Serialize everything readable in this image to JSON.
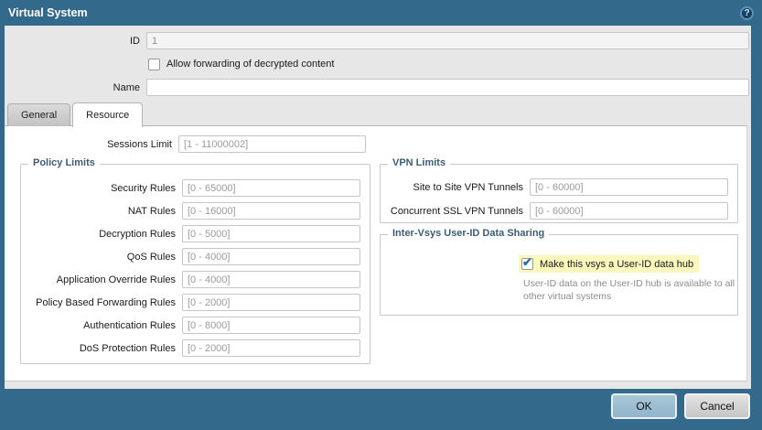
{
  "dialog": {
    "title": "Virtual System",
    "help_icon_glyph": "?",
    "top": {
      "id_label": "ID",
      "id_value": "1",
      "id_disabled": true,
      "forward_checkbox_label": "Allow forwarding of decrypted content",
      "forward_checkbox_checked": false,
      "name_label": "Name",
      "name_value": ""
    },
    "tabs": [
      {
        "label": "General",
        "active": false
      },
      {
        "label": "Resource",
        "active": true
      }
    ],
    "resource": {
      "sessions_label": "Sessions Limit",
      "sessions_placeholder": "[1 - 11000002]",
      "policy_limits": {
        "legend": "Policy Limits",
        "fields": [
          {
            "label": "Security Rules",
            "placeholder": "[0 - 65000]"
          },
          {
            "label": "NAT Rules",
            "placeholder": "[0 - 16000]"
          },
          {
            "label": "Decryption Rules",
            "placeholder": "[0 - 5000]"
          },
          {
            "label": "QoS Rules",
            "placeholder": "[0 - 4000]"
          },
          {
            "label": "Application Override Rules",
            "placeholder": "[0 - 4000]"
          },
          {
            "label": "Policy Based Forwarding Rules",
            "placeholder": "[0 - 2000]"
          },
          {
            "label": "Authentication Rules",
            "placeholder": "[0 - 8000]"
          },
          {
            "label": "DoS Protection Rules",
            "placeholder": "[0 - 2000]"
          }
        ]
      },
      "vpn_limits": {
        "legend": "VPN Limits",
        "fields": [
          {
            "label": "Site to Site VPN Tunnels",
            "placeholder": "[0 - 60000]"
          },
          {
            "label": "Concurrent SSL VPN Tunnels",
            "placeholder": "[0 - 60000]"
          }
        ]
      },
      "user_id_sharing": {
        "legend": "Inter-Vsys User-ID Data Sharing",
        "checkbox_label": "Make this vsys a User-ID data hub",
        "checkbox_checked": true,
        "help_text": "User-ID data on the User-ID hub is available to all other virtual systems"
      }
    },
    "footer": {
      "ok_label": "OK",
      "cancel_label": "Cancel"
    },
    "colors": {
      "chrome_teal": "#33698B",
      "body_gray": "#E7E7E7",
      "legend_blue": "#3D5C73",
      "highlight_yellow": "#FAF8BC",
      "check_teal": "#2C718F",
      "ok_button_blue": "#9CBCCE"
    }
  }
}
